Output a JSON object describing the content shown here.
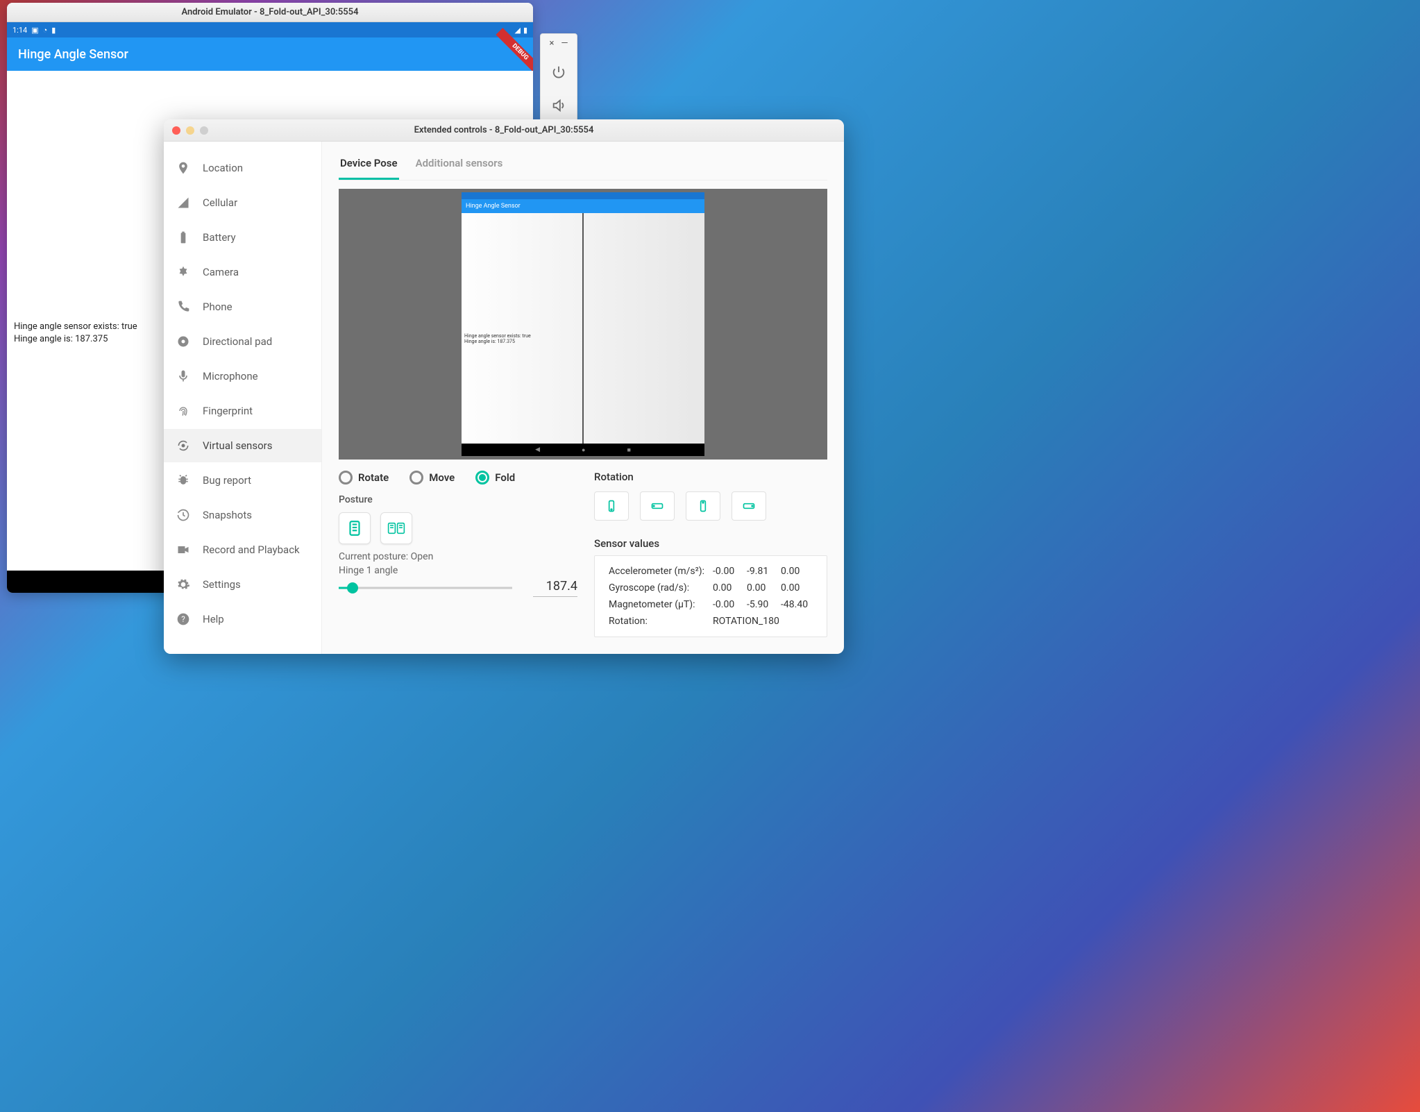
{
  "emulator": {
    "window_title": "Android Emulator - 8_Fold-out_API_30:5554",
    "status_time": "1:14",
    "debug_label": "DEBUG",
    "app_title": "Hinge Angle Sensor",
    "body_line1": "Hinge angle sensor exists: true",
    "body_line2": "Hinge angle is: 187.375"
  },
  "emu_toolbar": {
    "close_glyph": "×",
    "min_glyph": "—"
  },
  "ext": {
    "window_title": "Extended controls - 8_Fold-out_API_30:5554",
    "sidebar": [
      {
        "key": "location",
        "label": "Location"
      },
      {
        "key": "cellular",
        "label": "Cellular"
      },
      {
        "key": "battery",
        "label": "Battery"
      },
      {
        "key": "camera",
        "label": "Camera"
      },
      {
        "key": "phone",
        "label": "Phone"
      },
      {
        "key": "dpad",
        "label": "Directional pad"
      },
      {
        "key": "microphone",
        "label": "Microphone"
      },
      {
        "key": "fingerprint",
        "label": "Fingerprint"
      },
      {
        "key": "virtualsensors",
        "label": "Virtual sensors",
        "selected": true
      },
      {
        "key": "bugreport",
        "label": "Bug report"
      },
      {
        "key": "snapshots",
        "label": "Snapshots"
      },
      {
        "key": "record",
        "label": "Record and Playback"
      },
      {
        "key": "settings",
        "label": "Settings"
      },
      {
        "key": "help",
        "label": "Help"
      }
    ],
    "tabs": {
      "device_pose": "Device Pose",
      "additional": "Additional sensors"
    },
    "preview": {
      "appbar": "Hinge Angle Sensor",
      "line1": "Hinge angle sensor exists: true",
      "line2": "Hinge angle is: 187.375"
    },
    "pose": {
      "radio_rotate": "Rotate",
      "radio_move": "Move",
      "radio_fold": "Fold",
      "selected": "Fold",
      "posture_label": "Posture",
      "current_posture": "Current posture: Open",
      "hinge_label": "Hinge 1 angle",
      "hinge_value": "187.4",
      "hinge_fill_pct": 8
    },
    "rotation": {
      "label": "Rotation"
    },
    "sensor_values": {
      "heading": "Sensor values",
      "rows": [
        {
          "label": "Accelerometer (m/s²):",
          "x": "-0.00",
          "y": "-9.81",
          "z": "0.00"
        },
        {
          "label": "Gyroscope (rad/s):",
          "x": "0.00",
          "y": "0.00",
          "z": "0.00"
        },
        {
          "label": "Magnetometer (μT):",
          "x": "-0.00",
          "y": "-5.90",
          "z": "-48.40"
        }
      ],
      "rotation_label": "Rotation:",
      "rotation_value": "ROTATION_180"
    }
  }
}
